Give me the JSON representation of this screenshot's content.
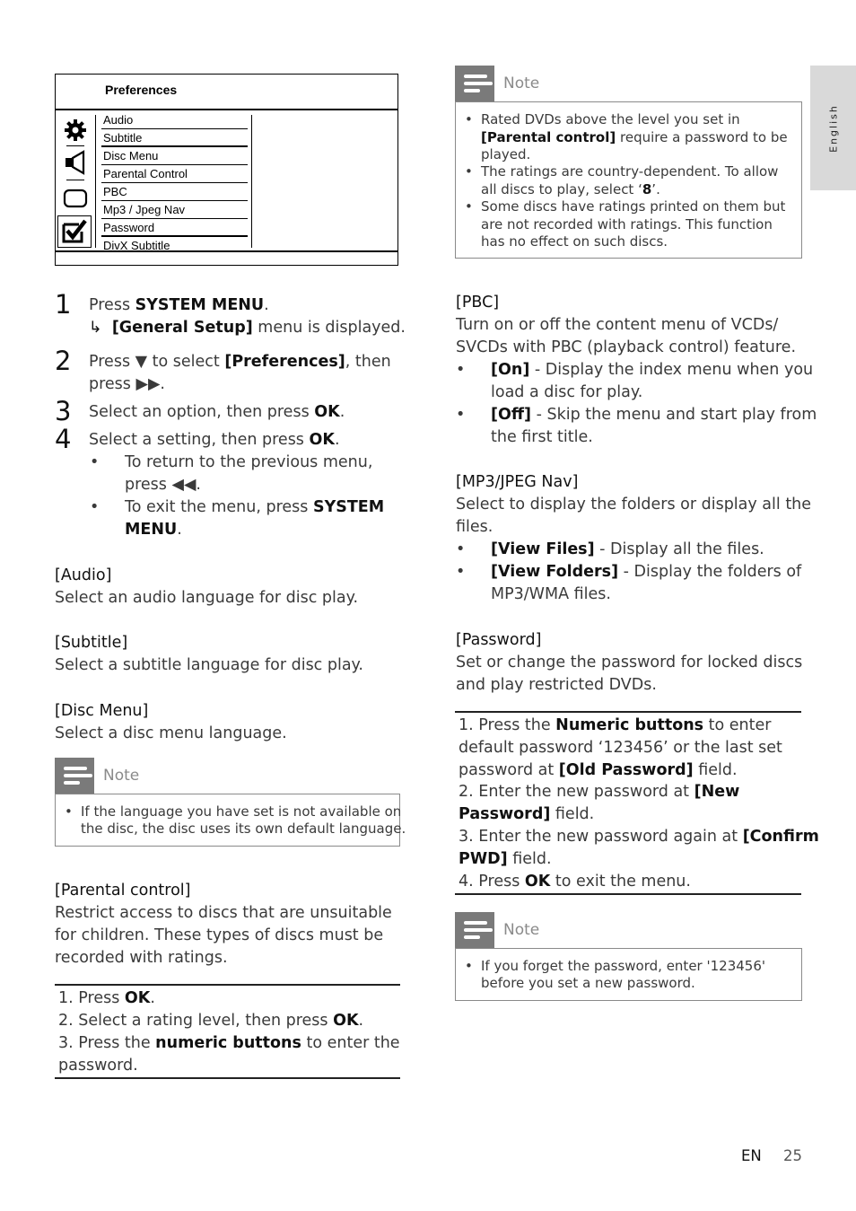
{
  "side_tab": {
    "label": "English"
  },
  "preferences_menu": {
    "title": "Preferences",
    "icons": [
      "gear-icon",
      "speaker-icon",
      "display-icon",
      "checkbox-icon"
    ],
    "items": [
      "Audio",
      "Subtitle",
      "Disc Menu",
      "Parental Control",
      "PBC",
      "Mp3 / Jpeg Nav",
      "Password",
      "DivX Subtitle"
    ],
    "selected_icon": "checkbox-icon"
  },
  "steps": [
    {
      "num": "1",
      "pre": "Press ",
      "bold": "SYSTEM MENU",
      "post": "."
    },
    {
      "result_arrow": "↳",
      "bold": "[General Setup]",
      "post": " menu is displayed."
    },
    {
      "num": "2",
      "pre": "Press ▼ to select ",
      "bold": "[Preferences]",
      "post": ", then",
      "line2": "press ▶▶."
    },
    {
      "num": "3",
      "pre": "Select an option, then press ",
      "bold": "OK",
      "post": "."
    },
    {
      "num": "4",
      "pre": "Select a setting, then press ",
      "bold": "OK",
      "post": "."
    }
  ],
  "sub_bullets": [
    {
      "line1": "To return to the previous menu,",
      "line2": "press ◀◀."
    },
    {
      "line1_pre": "To exit the menu, press ",
      "line1_bold": "SYSTEM",
      "line2_bold": "MENU",
      "line2_post": "."
    }
  ],
  "sections_left": {
    "audio": {
      "title": "[Audio]",
      "body": "Select an audio language for disc play."
    },
    "subtitle": {
      "title": "[Subtitle]",
      "body": "Select a subtitle language for disc play."
    },
    "disc_menu": {
      "title": "[Disc Menu]",
      "body": "Select a disc menu language."
    },
    "disc_menu_note": {
      "label": "Note",
      "items": [
        [
          "If the language you have set is not available on",
          "the disc, the disc uses its own default language."
        ]
      ]
    },
    "parental": {
      "title": "[Parental control]",
      "body": [
        "Restrict access to discs that are unsuitable",
        "for children. These types of discs must be",
        "recorded with ratings."
      ],
      "steps": [
        {
          "pre": "1. Press ",
          "bold": "OK",
          "post": "."
        },
        {
          "pre": "2. Select a rating level, then press ",
          "bold": "OK",
          "post": "."
        },
        {
          "pre": "3. Press the ",
          "bold": "numeric buttons",
          "post": " to enter the"
        },
        {
          "pre": "password.",
          "bold": "",
          "post": ""
        }
      ]
    }
  },
  "parental_note": {
    "label": "Note",
    "items": [
      {
        "lines": [
          [
            "Rated DVDs above the level you set in",
            ""
          ],
          [
            "",
            "[Parental control]",
            " require a password to be"
          ],
          [
            "played.",
            ""
          ]
        ]
      },
      {
        "lines": [
          [
            "The ratings are country-dependent. To allow",
            ""
          ],
          [
            "all discs to play, select ‘",
            "8",
            "’."
          ]
        ]
      },
      {
        "lines": [
          [
            "Some discs have ratings printed on them but",
            ""
          ],
          [
            "are not recorded with ratings. This function",
            ""
          ],
          [
            "has no effect on such discs.",
            ""
          ]
        ]
      }
    ]
  },
  "sections_right": {
    "pbc": {
      "title": "[PBC]",
      "body": [
        "Turn on or off the content menu of VCDs/",
        "SVCDs with PBC (playback control) feature."
      ],
      "options": [
        {
          "bold": "[On]",
          "line1": " - Display the index menu when you",
          "line2": "load a disc for play."
        },
        {
          "bold": "[Off]",
          "line1": " - Skip the menu and start play from",
          "line2": "the first title."
        }
      ]
    },
    "mp3": {
      "title": "[MP3/JPEG Nav]",
      "body": [
        "Select to display the folders or display all the",
        "files."
      ],
      "options": [
        {
          "bold": "[View Files]",
          "line1": " - Display all the files.",
          "line2": ""
        },
        {
          "bold": "[View Folders]",
          "line1": " - Display the folders of",
          "line2": "MP3/WMA files."
        }
      ]
    },
    "password": {
      "title": "[Password]",
      "body": [
        "Set or change the password for locked discs",
        "and play restricted DVDs."
      ],
      "steps": [
        {
          "pre": "1. Press the ",
          "bold": "Numeric buttons",
          "post": " to enter"
        },
        {
          "pre": "default password ‘123456’ or the last set",
          "bold": "",
          "post": ""
        },
        {
          "pre": "password at ",
          "bold": "[Old Password]",
          "post": " field."
        },
        {
          "pre": "2. Enter the new password at ",
          "bold": "[New",
          "post": ""
        },
        {
          "pre": "",
          "bold": "Password]",
          "post": " field."
        },
        {
          "pre": "3. Enter the new password again at ",
          "bold": "[Confirm",
          "post": ""
        },
        {
          "pre": "",
          "bold": "PWD]",
          "post": " field."
        },
        {
          "pre": "4. Press ",
          "bold": "OK",
          "post": " to exit the menu."
        }
      ]
    },
    "password_note": {
      "label": "Note",
      "items": [
        [
          "If you forget the password, enter '123456'",
          "before you set a new password."
        ]
      ]
    }
  },
  "footer": {
    "lang": "EN",
    "page": "25"
  }
}
